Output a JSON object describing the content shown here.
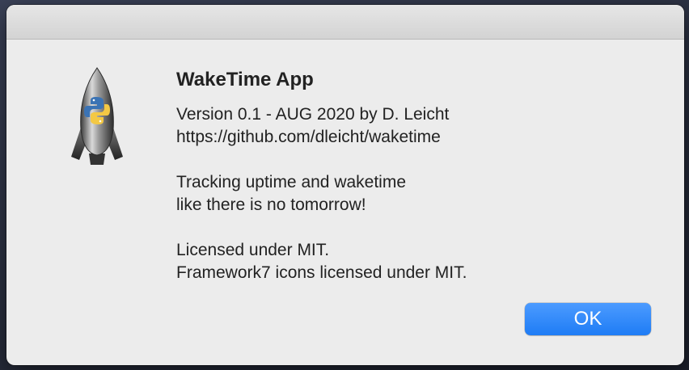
{
  "dialog": {
    "title": "WakeTime App",
    "version_line": "Version 0.1 - AUG 2020 by D. Leicht",
    "url_line": "https://github.com/dleicht/waketime",
    "tagline_1": "Tracking uptime and waketime",
    "tagline_2": "like there is no tomorrow!",
    "license_1": "Licensed under MIT.",
    "license_2": "Framework7 icons licensed under MIT.",
    "ok_label": "OK",
    "icon": "python-rocket-icon"
  },
  "colors": {
    "dialog_bg": "#ececec",
    "button_blue": "#1e7cf5",
    "text": "#222222"
  }
}
